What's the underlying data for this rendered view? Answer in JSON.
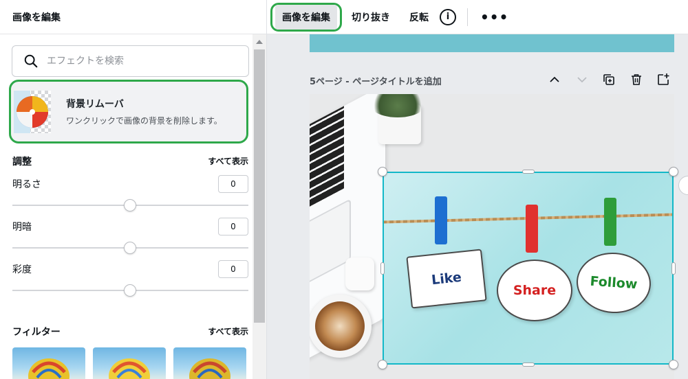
{
  "panel": {
    "title": "画像を編集",
    "search_placeholder": "エフェクトを検索",
    "bg_remover": {
      "title": "背景リムーバ",
      "description": "ワンクリックで画像の背景を削除します。"
    },
    "adjust": {
      "title": "調整",
      "see_all": "すべて表示",
      "items": [
        {
          "label": "明るさ",
          "value": "0",
          "level": 0.5
        },
        {
          "label": "明暗",
          "value": "0",
          "level": 0.5
        },
        {
          "label": "彩度",
          "value": "0",
          "level": 0.5
        }
      ]
    },
    "filters": {
      "title": "フィルター",
      "see_all": "すべて表示"
    }
  },
  "toolbar": {
    "edit_image": "画像を編集",
    "crop": "切り抜き",
    "flip": "反転",
    "info_icon": "i",
    "more": "•••"
  },
  "canvas": {
    "page_title": "5ページ - ページタイトルを追加",
    "bubbles": {
      "like": "Like",
      "share": "Share",
      "follow": "Follow"
    }
  },
  "colors": {
    "highlight": "#2ea84a",
    "selection": "#13b8c8",
    "accent_teal": "#70c2cf",
    "pin_blue": "#1d6fd1",
    "pin_red": "#e0312f",
    "pin_green": "#2e9d3a"
  }
}
